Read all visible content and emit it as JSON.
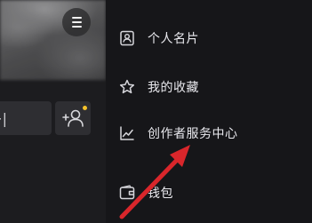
{
  "left_panel": {
    "edit_button_glyph": "+|",
    "menu_icon": "hamburger-menu-icon",
    "add_friend_icon": "add-friend-icon",
    "notification_dot_color": "#f5c32b"
  },
  "drawer": {
    "items": [
      {
        "label": "个人名片",
        "icon": "id-card-icon"
      },
      {
        "label": "我的收藏",
        "icon": "star-icon"
      },
      {
        "label": "创作者服务中心",
        "icon": "trend-chart-icon"
      },
      {
        "label": "钱包",
        "icon": "wallet-icon"
      }
    ]
  },
  "annotation": {
    "color": "#d9262b",
    "target": "创作者服务中心"
  }
}
